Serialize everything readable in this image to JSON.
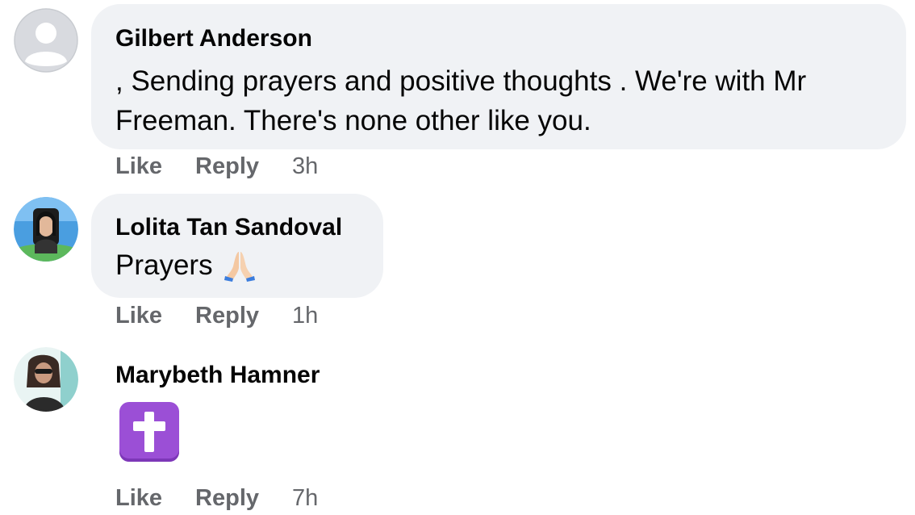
{
  "comments": [
    {
      "author": "Gilbert Anderson",
      "text": ", Sending prayers and positive thoughts . We're with Mr Freeman. There's none other like you.",
      "like": "Like",
      "reply": "Reply",
      "time": "3h"
    },
    {
      "author": "Lolita Tan Sandoval",
      "text": "Prayers",
      "emoji": "folded-hands-icon",
      "like": "Like",
      "reply": "Reply",
      "time": "1h"
    },
    {
      "author": "Marybeth Hamner",
      "emoji": "latin-cross-icon",
      "like": "Like",
      "reply": "Reply",
      "time": "7h"
    }
  ],
  "colors": {
    "bubble": "#f0f2f5",
    "meta": "#65676b",
    "cross_bg": "#9b4fd6"
  }
}
